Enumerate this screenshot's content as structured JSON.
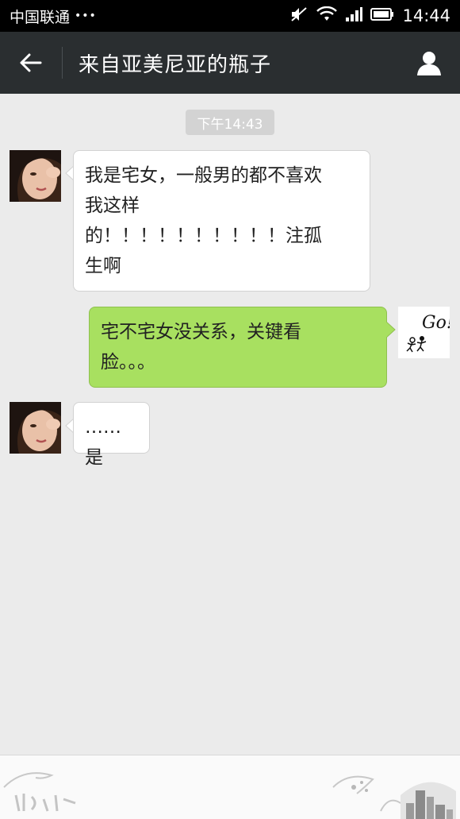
{
  "status_bar": {
    "carrier": "中国联通",
    "dots": "•••",
    "time": "14:44"
  },
  "header": {
    "title": "来自亚美尼亚的瓶子"
  },
  "chat": {
    "timestamp": "下午14:43",
    "messages": [
      {
        "direction": "in",
        "lines": [
          "我是宅女，一般男的都不喜欢",
          "我这样",
          "的！！！！！！！！！！注孤",
          "生啊"
        ]
      },
      {
        "direction": "out",
        "lines": [
          "宅不宅女没关系，关键看",
          "脸。。。"
        ]
      },
      {
        "direction": "in",
        "lines": [
          "……是"
        ]
      }
    ]
  },
  "avatars": {
    "self_sticker_text": "Go!"
  },
  "colors": {
    "header_bg": "#2a2e30",
    "chat_bg": "#ebebeb",
    "bubble_out": "#a8e060",
    "bubble_in": "#ffffff"
  }
}
